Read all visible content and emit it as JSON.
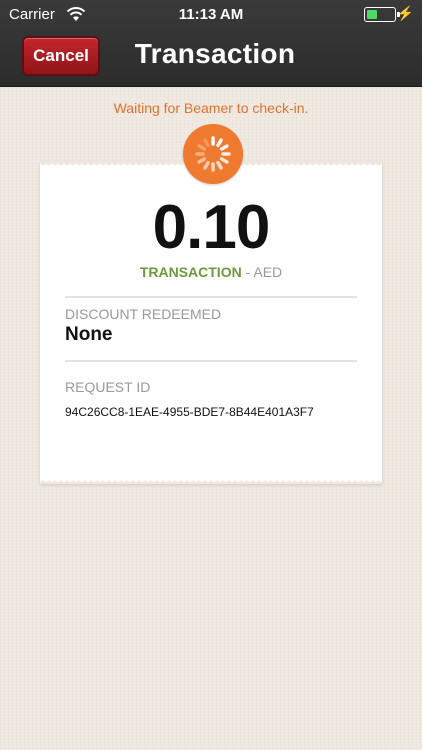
{
  "status_bar": {
    "carrier": "Carrier",
    "time": "11:13 AM"
  },
  "nav": {
    "cancel_label": "Cancel",
    "title": "Transaction"
  },
  "banner": {
    "waiting_text": "Waiting for Beamer to check-in."
  },
  "receipt": {
    "amount": "0.10",
    "transaction_label": "TRANSACTION",
    "currency_suffix": "- AED",
    "discount_label": "DISCOUNT REDEEMED",
    "discount_value": "None",
    "request_label": "REQUEST ID",
    "request_id": "94C26CC8-1EAE-4955-BDE7-8B44E401A3F7"
  },
  "colors": {
    "accent_orange": "#ef7a2f",
    "transaction_green": "#6b9a3e",
    "cancel_red": "#c4272d"
  },
  "icons": [
    "wifi-icon",
    "battery-icon",
    "charging-icon",
    "spinner-icon"
  ]
}
